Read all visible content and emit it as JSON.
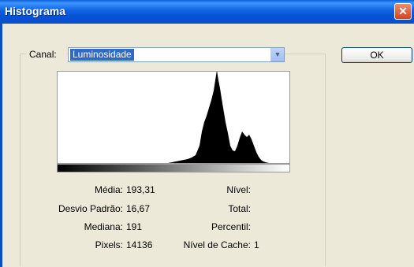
{
  "window": {
    "title": "Histograma",
    "close_symbol": "✕"
  },
  "channel": {
    "label": "Canal:",
    "value": "Luminosidade",
    "arrow": "▼"
  },
  "buttons": {
    "ok": "OK"
  },
  "stats": {
    "media": {
      "label": "Média:",
      "value": "193,31"
    },
    "desvio": {
      "label": "Desvio Padrão:",
      "value": "16,67"
    },
    "mediana": {
      "label": "Mediana:",
      "value": "191"
    },
    "pixels": {
      "label": "Pixels:",
      "value": "14136"
    },
    "nivel": {
      "label": "Nível:",
      "value": ""
    },
    "total": {
      "label": "Total:",
      "value": ""
    },
    "percentil": {
      "label": "Percentil:",
      "value": ""
    },
    "cache": {
      "label": "Nível de Cache:",
      "value": "1"
    }
  },
  "histogram_profile": [
    [
      0,
      0
    ],
    [
      140,
      0
    ],
    [
      145,
      1
    ],
    [
      150,
      2
    ],
    [
      155,
      3
    ],
    [
      160,
      4
    ],
    [
      165,
      5
    ],
    [
      170,
      7
    ],
    [
      175,
      10
    ],
    [
      180,
      22
    ],
    [
      183,
      40
    ],
    [
      186,
      52
    ],
    [
      189,
      60
    ],
    [
      192,
      70
    ],
    [
      195,
      80
    ],
    [
      198,
      92
    ],
    [
      200,
      105
    ],
    [
      202,
      118
    ],
    [
      204,
      105
    ],
    [
      206,
      95
    ],
    [
      208,
      82
    ],
    [
      210,
      70
    ],
    [
      213,
      52
    ],
    [
      216,
      38
    ],
    [
      219,
      22
    ],
    [
      222,
      16
    ],
    [
      225,
      15
    ],
    [
      228,
      22
    ],
    [
      231,
      32
    ],
    [
      234,
      40
    ],
    [
      237,
      36
    ],
    [
      240,
      33
    ],
    [
      243,
      36
    ],
    [
      246,
      30
    ],
    [
      249,
      22
    ],
    [
      252,
      14
    ],
    [
      255,
      8
    ],
    [
      258,
      4
    ],
    [
      261,
      2
    ],
    [
      264,
      1
    ],
    [
      268,
      0
    ],
    [
      296,
      0
    ]
  ]
}
